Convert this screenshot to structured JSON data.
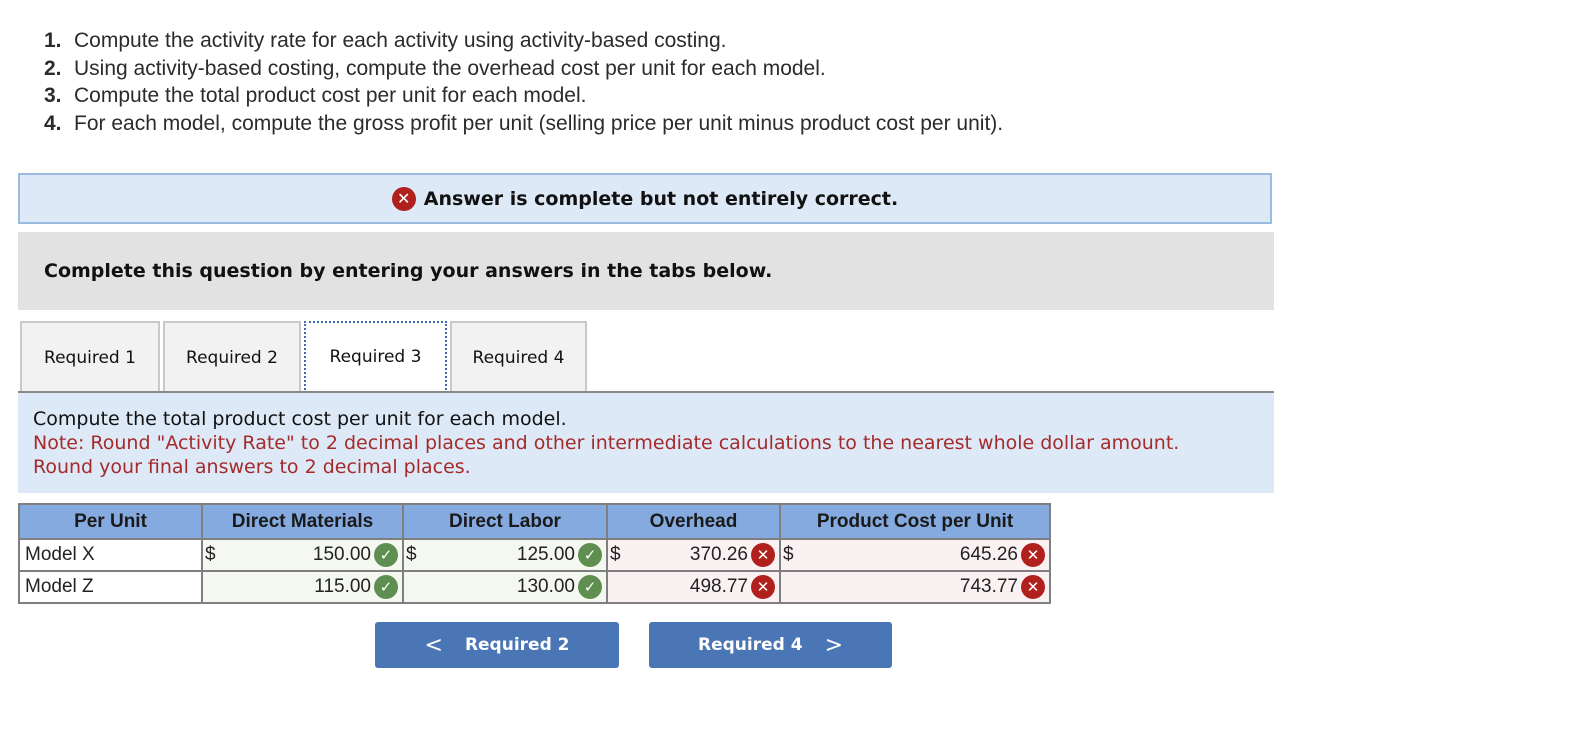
{
  "instructions": [
    {
      "num": "1.",
      "text": "Compute the activity rate for each activity using activity-based costing."
    },
    {
      "num": "2.",
      "text": "Using activity-based costing, compute the overhead cost per unit for each model."
    },
    {
      "num": "3.",
      "text": "Compute the total product cost per unit for each model."
    },
    {
      "num": "4.",
      "text": "For each model, compute the gross profit per unit (selling price per unit minus product cost per unit)."
    }
  ],
  "result_banner": {
    "icon": "x-circle-icon",
    "text": "Answer is complete but not entirely correct."
  },
  "instruction_box": "Complete this question by entering your answers in the tabs below.",
  "tabs": [
    {
      "label": "Required 1",
      "active": false
    },
    {
      "label": "Required 2",
      "active": false
    },
    {
      "label": "Required 3",
      "active": true
    },
    {
      "label": "Required 4",
      "active": false
    }
  ],
  "question": {
    "prompt": "Compute the total product cost per unit for each model.",
    "note_line1": "Note: Round \"Activity Rate\" to 2 decimal places and other intermediate calculations to the nearest whole dollar amount.",
    "note_line2": "Round your final answers to 2 decimal places."
  },
  "table": {
    "headers": [
      "Per Unit",
      "Direct Materials",
      "Direct Labor",
      "Overhead",
      "Product Cost per Unit"
    ],
    "rows": [
      {
        "label": "Model X",
        "cells": [
          {
            "currency": "$",
            "value": "150.00",
            "status": "correct"
          },
          {
            "currency": "$",
            "value": "125.00",
            "status": "correct"
          },
          {
            "currency": "$",
            "value": "370.26",
            "status": "incorrect"
          },
          {
            "currency": "$",
            "value": "645.26",
            "status": "incorrect"
          }
        ]
      },
      {
        "label": "Model Z",
        "cells": [
          {
            "currency": "",
            "value": "115.00",
            "status": "correct"
          },
          {
            "currency": "",
            "value": "130.00",
            "status": "correct"
          },
          {
            "currency": "",
            "value": "498.77",
            "status": "incorrect"
          },
          {
            "currency": "",
            "value": "743.77",
            "status": "incorrect"
          }
        ]
      }
    ],
    "status_glyphs": {
      "correct": "✓",
      "incorrect": "✕"
    }
  },
  "nav": {
    "prev_label": "Required 2",
    "next_label": "Required 4",
    "prev_glyph": "<",
    "next_glyph": ">"
  },
  "colors": {
    "banner_bg": "#dde9f7",
    "header_bg": "#84aadf",
    "button_bg": "#4b76b5",
    "correct": "#5f8f50",
    "incorrect": "#b0211e",
    "note_text": "#a52a2a"
  }
}
